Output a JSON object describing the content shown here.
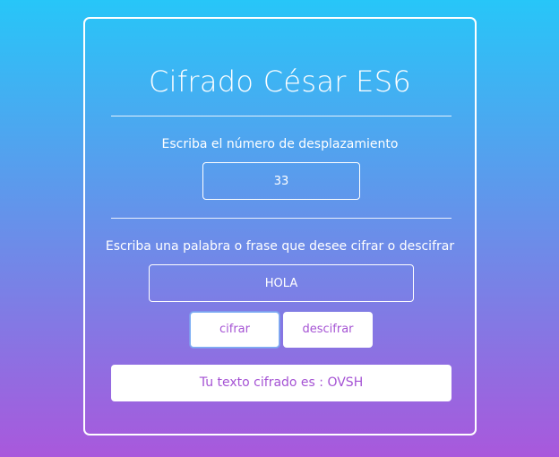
{
  "app": {
    "title": "Cifrado César ES6"
  },
  "shift": {
    "label": "Escriba el número de desplazamiento",
    "value": "33"
  },
  "message": {
    "label": "Escriba una palabra o frase que desee cifrar o descifrar",
    "value": "HOLA"
  },
  "actions": {
    "cipher_label": "cifrar",
    "decipher_label": "descifrar"
  },
  "result": {
    "text": "Tu texto cifrado es : OVSH"
  },
  "colors": {
    "gradient_top": "#27c6f8",
    "gradient_bottom": "#a958dc",
    "accent": "#a553d4"
  }
}
